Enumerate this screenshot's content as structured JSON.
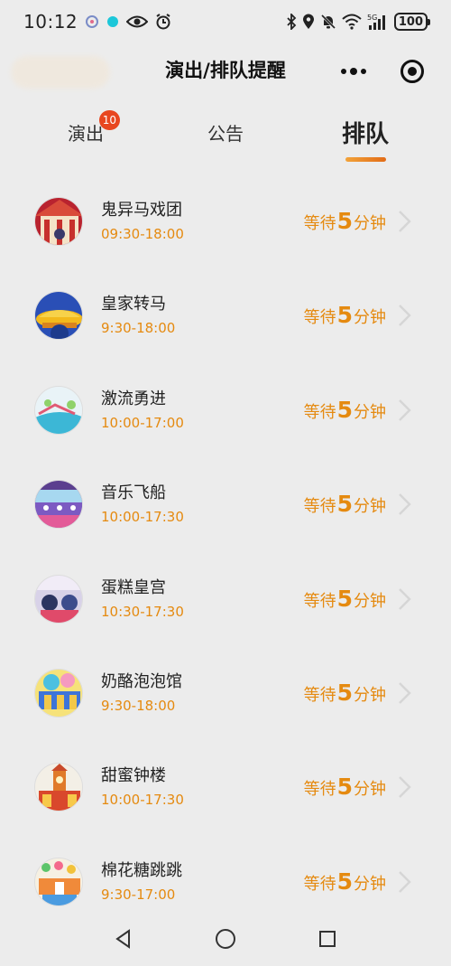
{
  "status_bar": {
    "time": "10:12",
    "battery": "100"
  },
  "header": {
    "title": "演出/排队提醒"
  },
  "tabs": [
    {
      "label": "演出",
      "badge": "10",
      "active": false
    },
    {
      "label": "公告",
      "active": false
    },
    {
      "label": "排队",
      "active": true
    }
  ],
  "wait_template": {
    "prefix": "等待",
    "suffix": "分钟"
  },
  "items": [
    {
      "name": "鬼异马戏团",
      "hours": "09:30-18:00",
      "wait": "5"
    },
    {
      "name": "皇家转马",
      "hours": "9:30-18:00",
      "wait": "5"
    },
    {
      "name": "激流勇进",
      "hours": "10:00-17:00",
      "wait": "5"
    },
    {
      "name": "音乐飞船",
      "hours": "10:00-17:30",
      "wait": "5"
    },
    {
      "name": "蛋糕皇宫",
      "hours": "10:30-17:30",
      "wait": "5"
    },
    {
      "name": "奶酪泡泡馆",
      "hours": "9:30-18:00",
      "wait": "5"
    },
    {
      "name": "甜蜜钟楼",
      "hours": "10:00-17:30",
      "wait": "5"
    },
    {
      "name": "棉花糖跳跳",
      "hours": "9:30-17:00",
      "wait": "5"
    }
  ],
  "colors": {
    "accent": "#e58a10",
    "badge": "#e8461f",
    "background": "#ececec"
  }
}
